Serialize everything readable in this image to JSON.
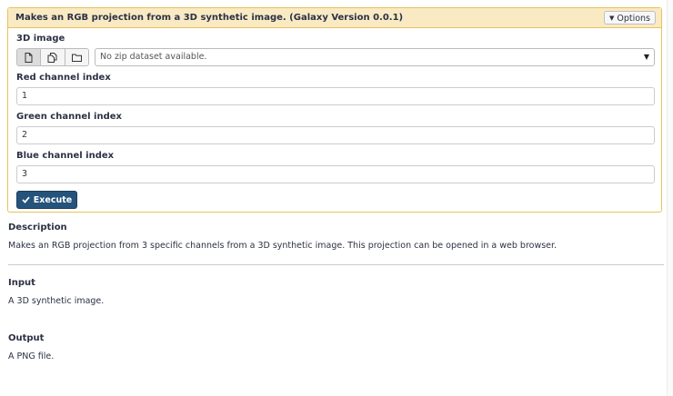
{
  "panel": {
    "title": "Makes an RGB projection from a 3D synthetic image. (Galaxy Version 0.0.1)",
    "options_label": "Options"
  },
  "form": {
    "image_label": "3D image",
    "image_select_value": "No zip dataset available.",
    "red_label": "Red channel index",
    "red_value": "1",
    "green_label": "Green channel index",
    "green_value": "2",
    "blue_label": "Blue channel index",
    "blue_value": "3",
    "execute_label": "Execute"
  },
  "help": {
    "description_heading": "Description",
    "description_text": "Makes an RGB projection from 3 specific channels from a 3D synthetic image. This projection can be opened in a web browser.",
    "input_heading": "Input",
    "input_text": "A 3D synthetic image.",
    "output_heading": "Output",
    "output_text": "A PNG file."
  },
  "icons": {
    "single_dataset": "file-icon",
    "multiple_datasets": "copy-icon",
    "collection": "folder-icon",
    "execute": "check-icon",
    "options_caret": "caret-down-icon",
    "select_caret": "caret-down-icon"
  }
}
